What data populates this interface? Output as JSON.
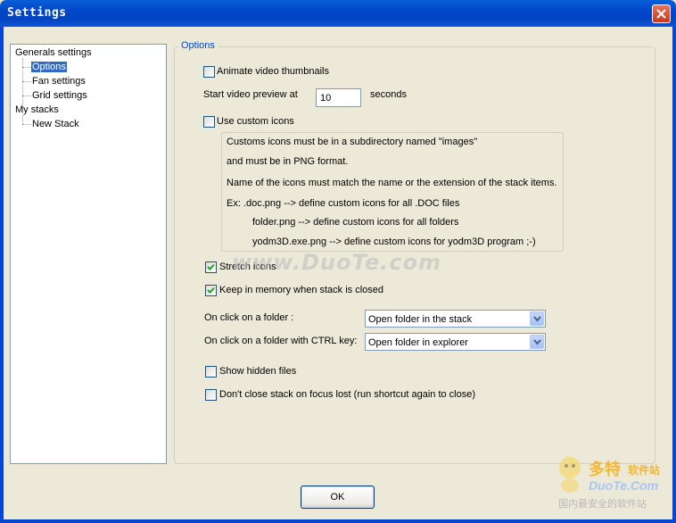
{
  "window": {
    "title": "Settings",
    "close_icon": "close-icon"
  },
  "tree": {
    "items": [
      {
        "label": "Generals settings",
        "selected": false
      },
      {
        "label": "Options",
        "selected": true
      },
      {
        "label": "Fan settings",
        "selected": false
      },
      {
        "label": "Grid settings",
        "selected": false
      },
      {
        "label": "My stacks",
        "selected": false
      },
      {
        "label": "New Stack",
        "selected": false
      }
    ]
  },
  "options": {
    "group_title": "Options",
    "animate_thumbnails": {
      "label": "Animate video thumbnails",
      "checked": false
    },
    "preview": {
      "label": "Start video preview at",
      "value": "10",
      "unit": "seconds"
    },
    "custom_icons": {
      "label": "Use custom icons",
      "checked": false
    },
    "info_lines": [
      "Customs icons must be in a subdirectory named \"images\"",
      "and must be in PNG format.",
      "Name of the icons must match the name or the extension of the stack items.",
      "Ex:   .doc.png       -->  define custom icons for all .DOC files",
      "folder.png     -->  define custom icons for all folders",
      "yodm3D.exe.png    -->  define custom icons for yodm3D program  ;-)"
    ],
    "stretch_icons": {
      "label": "Stretch icons",
      "checked": true
    },
    "keep_memory": {
      "label": "Keep in memory when stack is closed",
      "checked": true
    },
    "click_folder": {
      "label": "On click on a folder :",
      "value": "Open folder in the stack"
    },
    "click_folder_ctrl": {
      "label": "On click on a folder with CTRL key:",
      "value": "Open folder in explorer"
    },
    "show_hidden": {
      "label": "Show hidden files",
      "checked": false
    },
    "dont_close": {
      "label": "Don't close stack on focus lost  (run shortcut again to close)",
      "checked": false
    }
  },
  "buttons": {
    "ok": "OK"
  },
  "watermark": "www.DuoTe.com",
  "logo": {
    "cn": "多特",
    "cn_suffix": "软件站",
    "en": "DuoTe.Com",
    "tagline": "国内最安全的软件站"
  }
}
